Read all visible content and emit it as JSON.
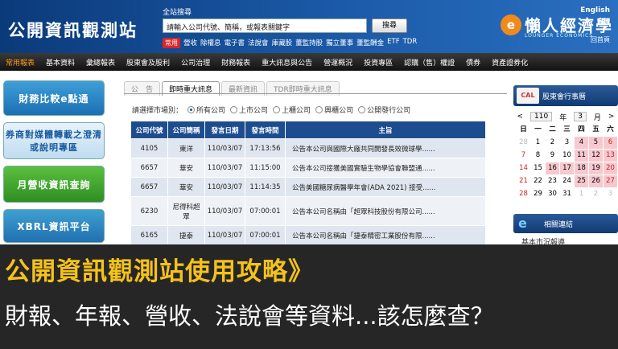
{
  "header": {
    "site_title": "公開資訊觀測站",
    "search_label": "全站搜尋",
    "search_placeholder": "請輸入公司代號、簡稱，或報表關鍵字",
    "search_button": "搜尋",
    "hot_tag": "常用",
    "hot_links": [
      "營收",
      "除權息",
      "電子書",
      "法說會",
      "庫藏股",
      "董監持股",
      "獨立董事",
      "董監酬金",
      "ETF",
      "TDR"
    ]
  },
  "brand": {
    "emblem": "e",
    "english": "English",
    "name": "懶人經濟學",
    "sub": "LOUNGER ECONOMICS",
    "home": "回首頁"
  },
  "nav": [
    "常用報表",
    "基本資料",
    "彙總報表",
    "股東會及股利",
    "公司治理",
    "財務報表",
    "重大訊息與公告",
    "營運概況",
    "投資專區",
    "認購（售）權證",
    "債券",
    "資產證券化"
  ],
  "left_banners": [
    "財務比較e點通",
    "券商對媒體轉載之澄清或說明專區",
    "月營收資訊查詢",
    "XBRL資訊平台"
  ],
  "tabs": [
    "公　告",
    "即時重大訊息",
    "最新資訊",
    "TDR即時重大訊息"
  ],
  "market": {
    "label": "請選擇市場別：",
    "options": [
      "所有公司",
      "上市公司",
      "上櫃公司",
      "興櫃公司",
      "公開發行公司"
    ]
  },
  "table": {
    "headers": [
      "公司代號",
      "公司簡稱",
      "發言日期",
      "發言時間",
      "主旨"
    ],
    "rows": [
      [
        "4105",
        "東洋",
        "110/03/07",
        "17:13:56",
        "公告本公司與國際大廠共同開發長效微球學......"
      ],
      [
        "6657",
        "華安",
        "110/03/07",
        "11:15:00",
        "公告本公司接獲美國實驗生物學協會聯盟通......"
      ],
      [
        "6657",
        "華安",
        "110/03/07",
        "11:14:35",
        "公告美國糖尿病醫學年會(ADA 2021) 接受......"
      ],
      [
        "6230",
        "尼得科超眾",
        "110/03/07",
        "07:00:01",
        "公告本公司名稱由「超眾科技股份有限公司......"
      ],
      [
        "6165",
        "捷泰",
        "110/03/07",
        "07:00:01",
        "公告本公司名稱由「捷泰精密工業股份有限......"
      ]
    ]
  },
  "calendar": {
    "title": "股東會行事曆",
    "icon_text": "CAL",
    "year": "110",
    "year_suffix": "年",
    "month": "3",
    "month_suffix": "月",
    "weekdays": [
      "日",
      "一",
      "二",
      "三",
      "四",
      "五",
      "六"
    ],
    "days": [
      "28",
      "1",
      "2",
      "3",
      "4",
      "5",
      "6",
      "7",
      "8",
      "9",
      "10",
      "11",
      "12",
      "13",
      "14",
      "15",
      "16",
      "17",
      "18",
      "19",
      "20",
      "21",
      "22",
      "23",
      "24",
      "25",
      "26",
      "27",
      "28",
      "29",
      "30",
      "31",
      "1",
      "2",
      "3"
    ]
  },
  "links": {
    "title": "相關連結",
    "item": "基本市況報導"
  },
  "banner": {
    "title": "公開資訊觀測站使用攻略》",
    "subtitle": "財報、年報、營收、法說會等資料...該怎麼查？"
  }
}
